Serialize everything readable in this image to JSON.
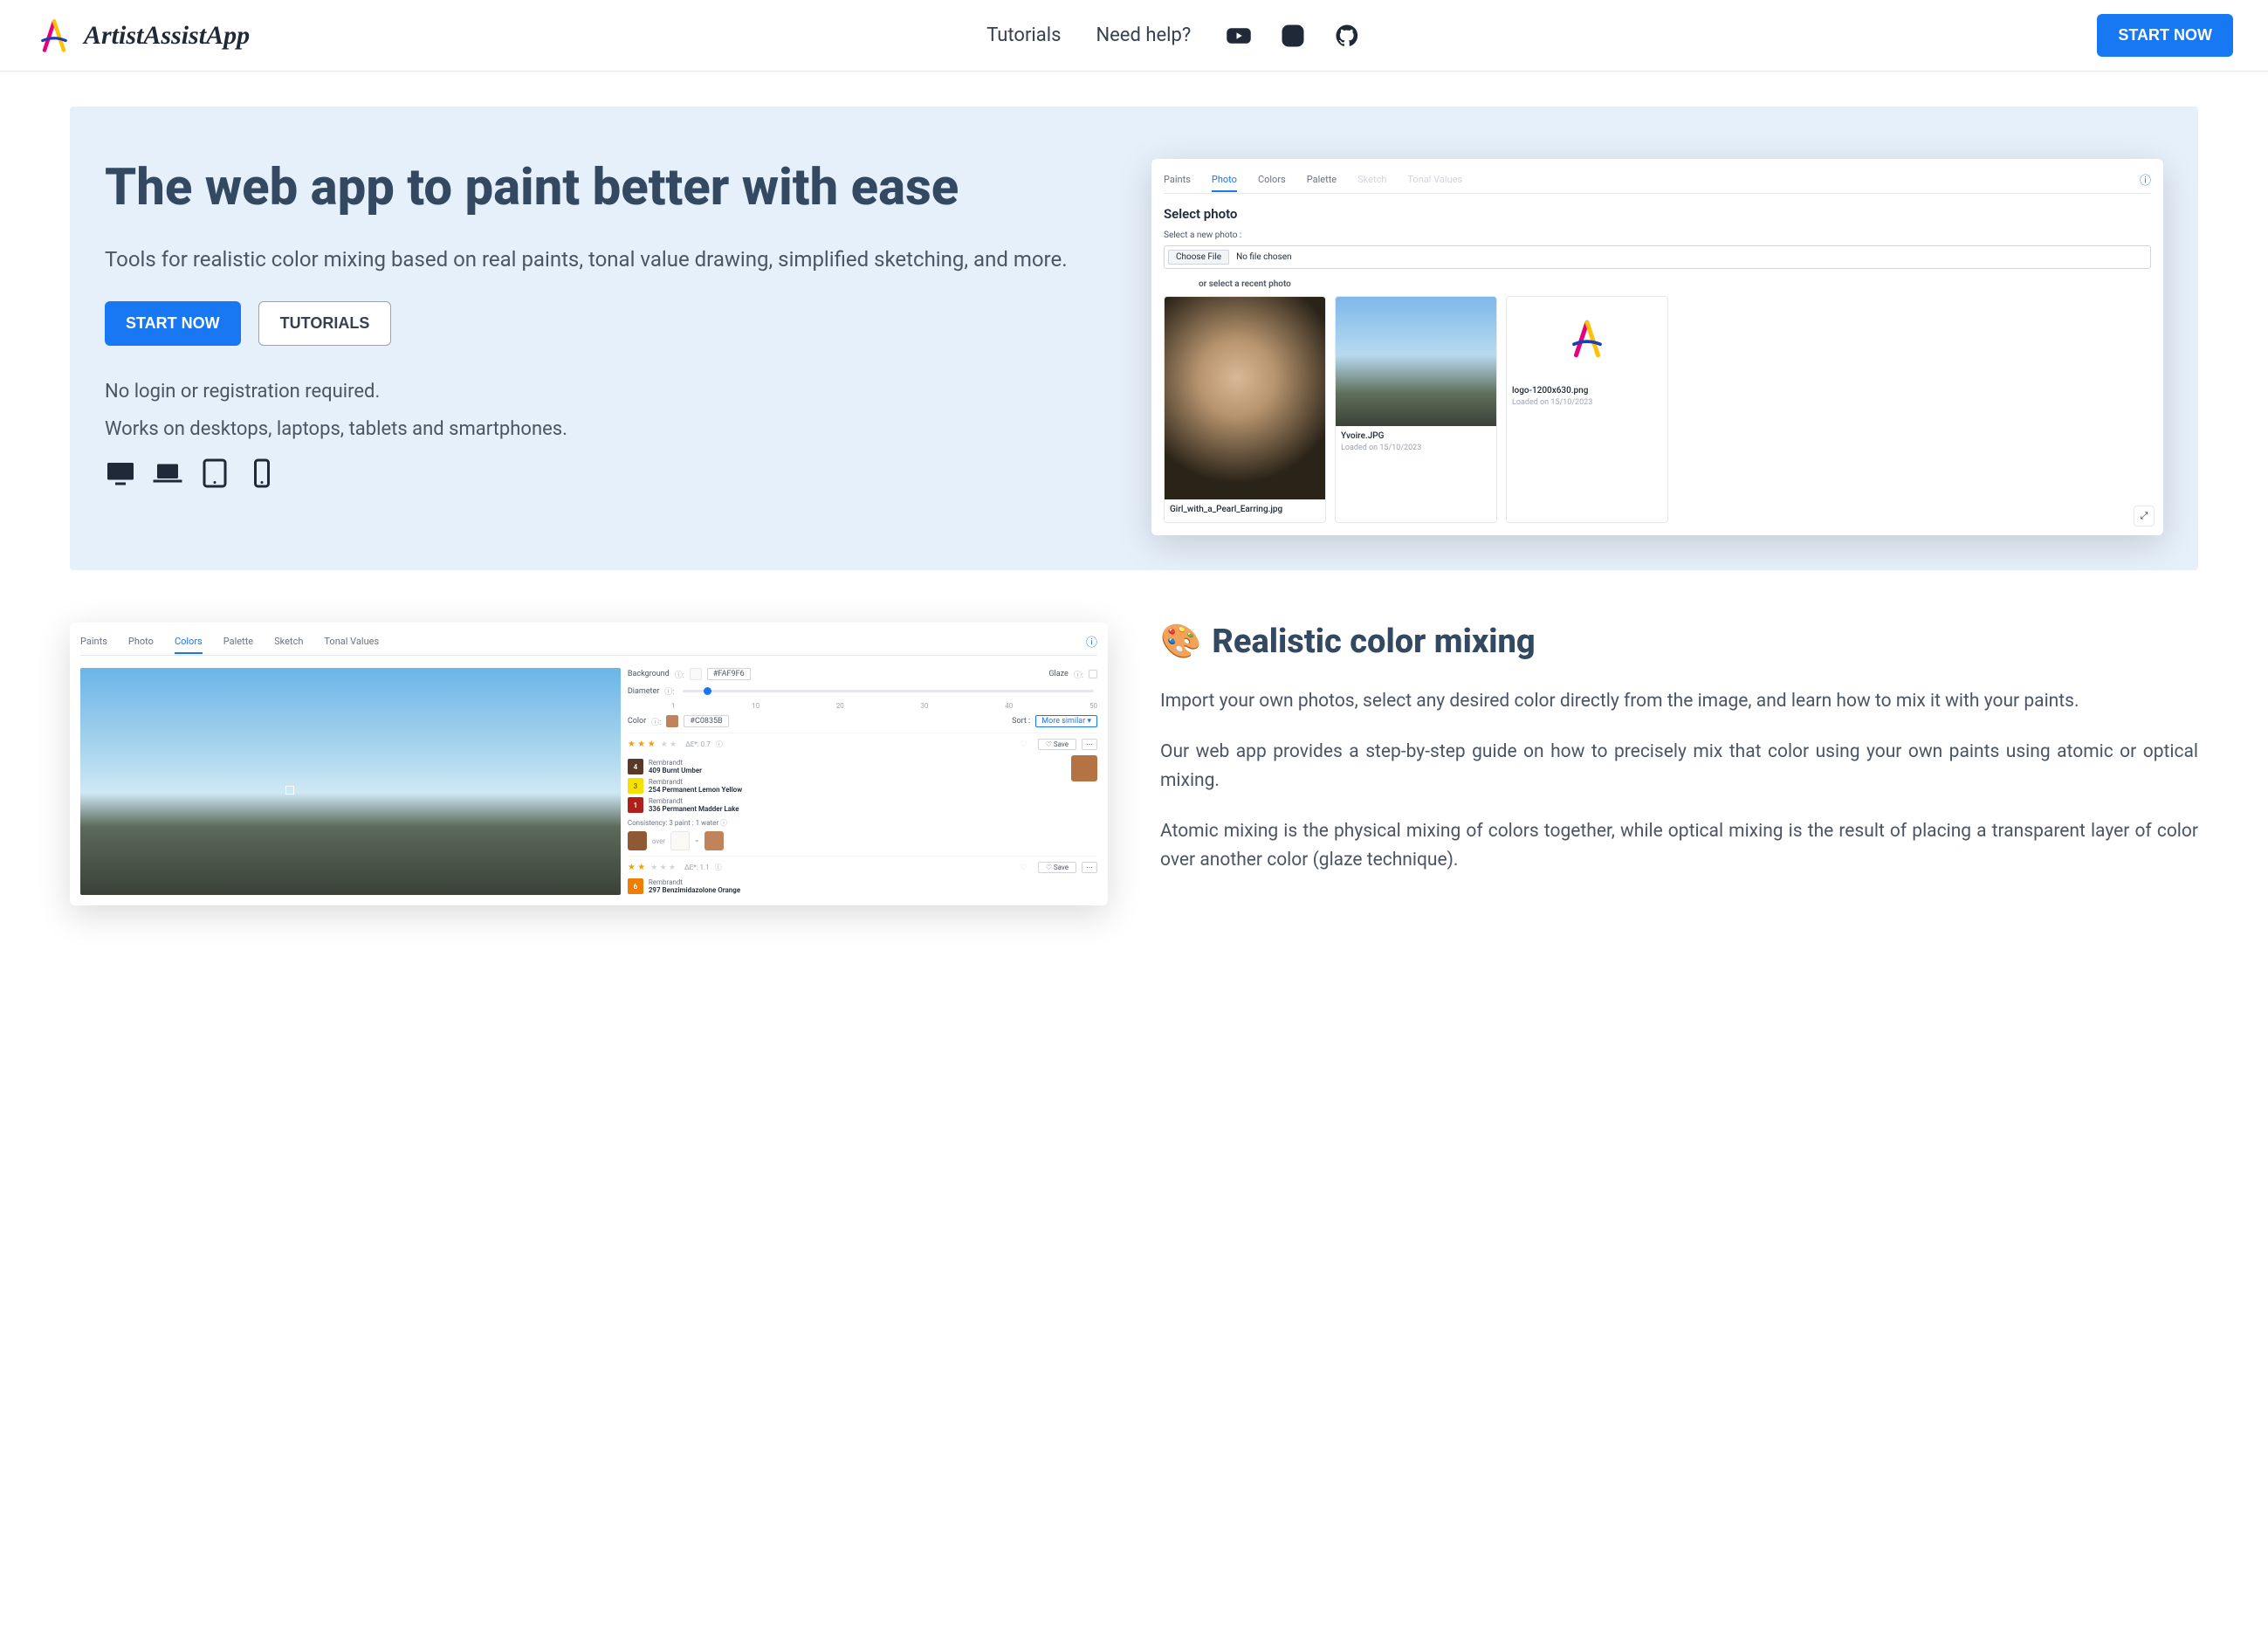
{
  "header": {
    "app_name": "ArtistAssistApp",
    "nav": {
      "tutorials": "Tutorials",
      "help": "Need help?"
    },
    "cta": "START NOW"
  },
  "hero": {
    "title": "The web app to paint better with ease",
    "subtitle": "Tools for realistic color mixing based on real paints, tonal value drawing, simplified sketching, and more.",
    "btn_start": "START NOW",
    "btn_tutorials": "TUTORIALS",
    "note1": "No login or registration required.",
    "note2": "Works on desktops, laptops, tablets and smartphones."
  },
  "screenshot1": {
    "tabs": [
      "Paints",
      "Photo",
      "Colors",
      "Palette",
      "Sketch",
      "Tonal Values"
    ],
    "active_tab": "Photo",
    "title": "Select photo",
    "new_photo_label": "Select a new photo :",
    "choose_file": "Choose File",
    "no_file": "No file chosen",
    "recent_label": "or select a recent photo",
    "photos": [
      {
        "name": "Girl_with_a_Pearl_Earring.jpg",
        "date": ""
      },
      {
        "name": "Yvoire.JPG",
        "date": "Loaded on 15/10/2023"
      },
      {
        "name": "logo-1200x630.png",
        "date": "Loaded on 15/10/2023"
      }
    ]
  },
  "section2": {
    "emoji": "🎨",
    "title": "Realistic color mixing",
    "p1": "Import your own photos, select any desired color directly from the image, and learn how to mix it with your paints.",
    "p2": "Our web app provides a step-by-step guide on how to precisely mix that color using your own paints using atomic or optical mixing.",
    "p3": "Atomic mixing is the physical mixing of colors together, while optical mixing is the result of placing a transparent layer of color over another color (glaze technique)."
  },
  "screenshot2": {
    "tabs": [
      "Paints",
      "Photo",
      "Colors",
      "Palette",
      "Sketch",
      "Tonal Values"
    ],
    "active_tab": "Colors",
    "background_label": "Background",
    "background_hex": "#FAF9F6",
    "glaze_label": "Glaze",
    "diameter_label": "Diameter",
    "diameter_ticks": [
      "1",
      "10",
      "20",
      "30",
      "40",
      "50"
    ],
    "color_label": "Color",
    "color_hex": "#C0835B",
    "sort_label": "Sort :",
    "sort_value": "More similar",
    "results": [
      {
        "stars": 3,
        "delta": "ΔE*: 0.7",
        "save": "Save",
        "paints": [
          {
            "qty": "4",
            "swatch": "#5a3a26",
            "brand": "Rembrandt",
            "name": "409 Burnt Umber"
          },
          {
            "qty": "3",
            "swatch": "#f5e000",
            "brand": "Rembrandt",
            "name": "254 Permanent Lemon Yellow"
          },
          {
            "qty": "1",
            "swatch": "#b0201b",
            "brand": "Rembrandt",
            "name": "336 Permanent Madder Lake"
          }
        ],
        "consistency": "Consistency: 3 paint : 1 water",
        "mix": {
          "left": "#8f5a33",
          "over": "over",
          "mid": "#faf9f6",
          "eq": "=",
          "right": "#c0835b"
        },
        "result_swatch": "#b57243"
      },
      {
        "stars": 2,
        "delta": "ΔE*: 1.1",
        "save": "Save",
        "paints": [
          {
            "qty": "6",
            "swatch": "#f07d00",
            "brand": "Rembrandt",
            "name": "297 Benzimidazolone Orange"
          }
        ]
      }
    ]
  }
}
